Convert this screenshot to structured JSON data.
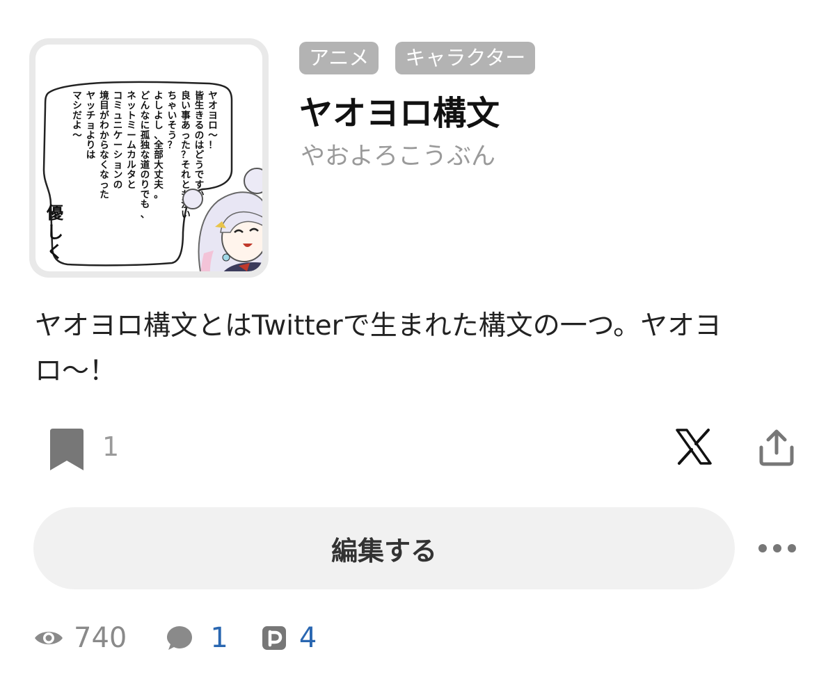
{
  "thumbnail": {
    "speech_lines": [
      "ヤオヨロ〜！",
      "皆生きるのはどうですか？",
      "良い事あった？それとも泣い",
      "ちゃいそう？",
      "よしよし、全部大丈夫。",
      "どんなに孤独な道のりでも、",
      "ネットミームカルタと",
      "コミュニケーションの",
      "境目がわからなくなった",
      "ヤッチョよりは",
      "マシだよ〜"
    ],
    "big_text": "優しく"
  },
  "tags": [
    "アニメ",
    "キャラクター"
  ],
  "title": "ヤオヨロ構文",
  "reading": "やおよろこうぶん",
  "description": "ヤオヨロ構文とはTwitterで生まれた構文の一つ。ヤオヨロ〜！",
  "actions": {
    "bookmark_count": "1",
    "edit_label": "編集する"
  },
  "stats": {
    "views": "740",
    "comments": "1",
    "pixiv": "4"
  },
  "colors": {
    "tag_bg": "#b3b3b3",
    "link_blue": "#2a67b1",
    "icon_gray": "#8a8a8a",
    "edit_bg": "#f1f1f1"
  }
}
